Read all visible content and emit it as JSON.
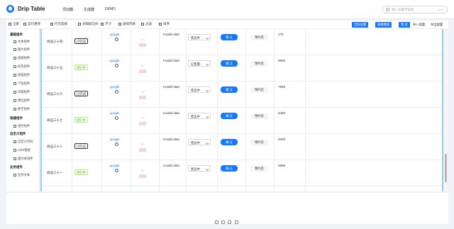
{
  "header": {
    "brand": "Drip Table",
    "nav": [
      "顶动器",
      "生成器",
      "DEMO"
    ],
    "search_placeholder": "输入关键字搜索",
    "search_shortcut": "Ctrl K",
    "accent": "#1677ff"
  },
  "toolbar": {
    "items": [
      "全部",
      "自行悬停",
      "行可选择",
      "间隔斑马纹",
      "尺寸",
      "虚拟列表",
      "过滤",
      "排序"
    ],
    "right_buttons": [
      "全局设置",
      "表格数据",
      "预 览",
      "导入配置",
      "导出配置"
    ]
  },
  "sidebar": {
    "groups": [
      {
        "title": "基础组件",
        "items": [
          "文本组件",
          "图片组件",
          "链接组件",
          "标签组件",
          "按钮组件",
          "下拉组件",
          "日期组件",
          "弹出组件",
          "数字组件"
        ]
      },
      {
        "title": "容器组件",
        "items": [
          "组合组件"
        ]
      },
      {
        "title": "自定义组件",
        "items": [
          "自定义代码",
          "CDN链接",
          "富文本组件"
        ]
      },
      {
        "title": "业务组件",
        "items": [
          "业务文本"
        ]
      }
    ]
  },
  "table": {
    "rows": [
      {
        "name": "商品三十四",
        "status": "已完成",
        "status_type": "done",
        "link": "google",
        "date": "Invalid date",
        "select": "售卖中",
        "button": "确 认",
        "label": "预约页",
        "number": "178"
      },
      {
        "name": "商品三十五",
        "status": "进行中",
        "status_type": "prog",
        "link": "google",
        "date": "Invalid date",
        "select": "已售罄",
        "button": "确 认",
        "label": "预约页",
        "number": "9999"
      },
      {
        "name": "商品三十六",
        "status": "已完成",
        "status_type": "done",
        "link": "google",
        "date": "Invalid date",
        "select": "售卖中",
        "button": "确 认",
        "label": "预约页",
        "number": "7999"
      },
      {
        "name": "商品三十七",
        "status": "进行中",
        "status_type": "prog",
        "link": "google",
        "date": "Invalid date",
        "select": "售卖中",
        "button": "确 认",
        "label": "预约页",
        "number": "6488"
      },
      {
        "name": "商品三十八",
        "status": "已完成",
        "status_type": "done",
        "link": "google",
        "date": "Invalid date",
        "select": "售卖中",
        "button": "确 认",
        "label": "预约页",
        "number": "2099"
      },
      {
        "name": "商品三十一",
        "status": "进行中",
        "status_type": "prog",
        "link": "google",
        "date": "Invalid date",
        "select": "售卖中",
        "button": "确 认",
        "label": "预约页",
        "number": "5999"
      }
    ]
  }
}
